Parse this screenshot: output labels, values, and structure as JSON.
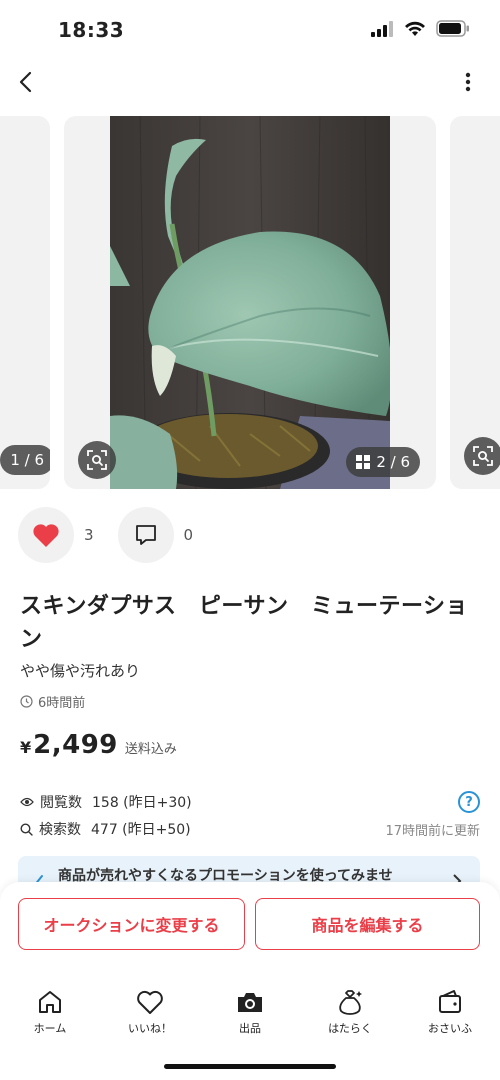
{
  "status_bar": {
    "time": "18:33"
  },
  "carousel": {
    "prev_counter": "1 / 6",
    "current_counter": "2 / 6",
    "accent": "#ea3f49"
  },
  "actions": {
    "like_count": "3",
    "comment_count": "0"
  },
  "product": {
    "title": "スキンダプサス　ピーサン　ミューテーション",
    "condition": "やや傷や汚れあり",
    "posted": "6時間前",
    "price_symbol": "¥",
    "price": "2,499",
    "shipping_note": "送料込み"
  },
  "stats": {
    "views_label": "閲覧数",
    "views_value": "158 (昨日+30)",
    "search_label": "検索数",
    "search_value": "477 (昨日+50)",
    "updated": "17時間前に更新"
  },
  "promo": {
    "text": "商品が売れやすくなるプロモーションを使ってみませ"
  },
  "buttons": {
    "auction": "オークションに変更する",
    "edit": "商品を編集する"
  },
  "tabs": [
    {
      "label": "ホーム",
      "icon": "home-icon"
    },
    {
      "label": "いいね！",
      "icon": "heart-outline-icon"
    },
    {
      "label": "出品",
      "icon": "camera-icon"
    },
    {
      "label": "はたらく",
      "icon": "money-bag-icon"
    },
    {
      "label": "おさいふ",
      "icon": "wallet-icon"
    }
  ]
}
